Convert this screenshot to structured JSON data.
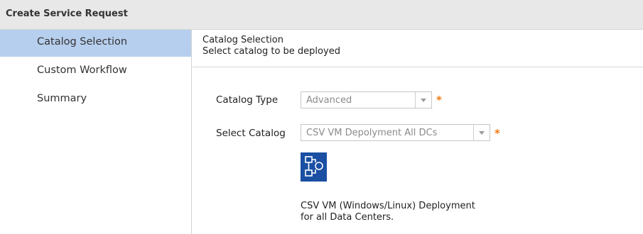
{
  "window": {
    "title": "Create Service Request"
  },
  "sidebar": {
    "items": [
      {
        "label": "Catalog Selection",
        "active": true
      },
      {
        "label": "Custom Workflow",
        "active": false
      },
      {
        "label": "Summary",
        "active": false
      }
    ]
  },
  "main": {
    "header_title": "Catalog Selection",
    "header_subtitle": "Select catalog to be deployed",
    "catalog_type": {
      "label": "Catalog Type",
      "value": "Advanced"
    },
    "select_catalog": {
      "label": "Select Catalog",
      "value": "CSV VM Depolyment All DCs"
    },
    "required_marker": "*",
    "catalog_icon": "workflow-diagram-icon",
    "description_line1": "CSV VM (Windows/Linux) Deployment",
    "description_line2": "for all Data Centers."
  },
  "colors": {
    "active_nav": "#b7cfee",
    "title_bar": "#e8e8e8",
    "required": "#f07a10",
    "icon_bg": "#1a4fa3"
  }
}
